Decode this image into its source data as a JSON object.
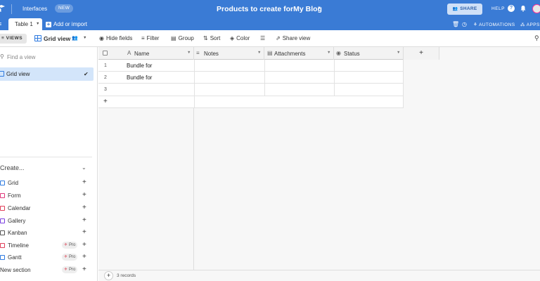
{
  "topbar": {
    "interfaces_label": "Interfaces",
    "new_badge": "NEW",
    "base_title": "Products to create forMy Blog",
    "share_label": "SHARE",
    "help_label": "HELP"
  },
  "tabbar": {
    "active_tab": "Table 1",
    "add_import": "Add or import",
    "automations": "AUTOMATIONS",
    "apps": "APPS"
  },
  "viewbar": {
    "views_label": "VIEWS",
    "current_view": "Grid view",
    "hide_fields": "Hide fields",
    "filter": "Filter",
    "group": "Group",
    "sort": "Sort",
    "color": "Color",
    "share_view": "Share view"
  },
  "sidebar": {
    "find_placeholder": "Find a view",
    "selected_view": "Grid view",
    "create_label": "Create...",
    "items": [
      {
        "label": "Grid",
        "icon": "grid-icon",
        "color": "#2f7be0",
        "pro": ""
      },
      {
        "label": "Form",
        "icon": "form-icon",
        "color": "#e0387b",
        "pro": ""
      },
      {
        "label": "Calendar",
        "icon": "calendar-icon",
        "color": "#e0405a",
        "pro": ""
      },
      {
        "label": "Gallery",
        "icon": "gallery-icon",
        "color": "#7b3fe0",
        "pro": ""
      },
      {
        "label": "Kanban",
        "icon": "kanban-icon",
        "color": "#555555",
        "pro": ""
      },
      {
        "label": "Timeline",
        "icon": "timeline-icon",
        "color": "#e0405a",
        "pro": "Pro"
      },
      {
        "label": "Gantt",
        "icon": "gantt-icon",
        "color": "#2f7be0",
        "pro": "Pro"
      },
      {
        "label": "New section",
        "icon": "",
        "color": "",
        "pro": "Pro"
      }
    ]
  },
  "grid": {
    "columns": [
      {
        "label": "Name",
        "icon": "text-field-icon"
      },
      {
        "label": "Notes",
        "icon": "long-text-icon"
      },
      {
        "label": "Attachments",
        "icon": "attachment-icon"
      },
      {
        "label": "Status",
        "icon": "single-select-icon"
      }
    ],
    "rows": [
      {
        "num": "1",
        "name": "Bundle for"
      },
      {
        "num": "2",
        "name": "Bundle for"
      },
      {
        "num": "3",
        "name": ""
      }
    ],
    "record_count": "3 records"
  }
}
